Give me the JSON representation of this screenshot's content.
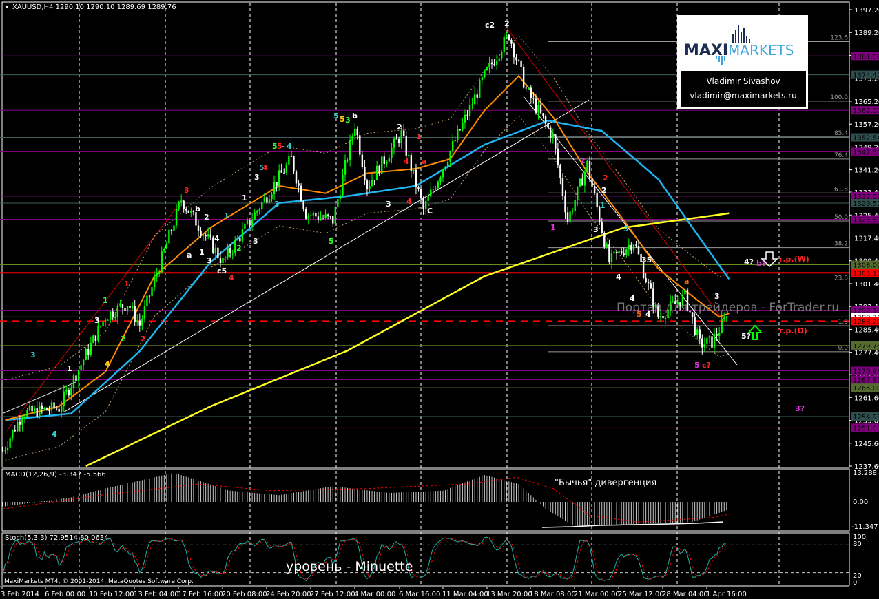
{
  "header": {
    "symbol_line": "XAUUSD,H4  1290.10  1290.10  1289.69  1289.76"
  },
  "footer": {
    "copyright": "MaxiMarkets MT4, © 2001-2014, MetaQuotes Software Corp."
  },
  "logo": {
    "brand_a": "MAXI",
    "brand_b": "MARKETS",
    "author": "Vladimir Sivashov",
    "email": "vladimir@maximarkets.ru"
  },
  "watermark": "Портал для трейдеров - ForTrader.ru",
  "captions": {
    "divergence": "\"Бычья\" дивергенция",
    "level": "уровень - Minuette"
  },
  "targets": {
    "w": "т.р.(W)",
    "d": "т.р.(D)"
  },
  "colors": {
    "bull": "#00ff00",
    "bear": "#ffffff",
    "ma_fast": "#ff8c00",
    "ma_mid": "#1eb4f0",
    "ma_slow": "#ffff22",
    "support": "#ff0000",
    "level_purple": "#b000b0"
  },
  "chart_data": {
    "type": "candlestick",
    "title": "XAUUSD,H4",
    "ohlc_last": {
      "open": 1290.1,
      "high": 1290.1,
      "low": 1289.69,
      "close": 1289.76
    },
    "ylim": [
      1237.6,
      1397.2
    ],
    "price_ticks": [
      "1397.20",
      "1389.20",
      "1381.20",
      "1373.20",
      "1365.20",
      "1357.20",
      "1349.20",
      "1341.20",
      "1333.40",
      "1325.40",
      "1317.40",
      "1309.40",
      "1301.40",
      "1293.40",
      "1285.40",
      "1277.40",
      "1269.60",
      "1261.60",
      "1253.60",
      "1245.60",
      "1237.60"
    ],
    "time_ticks": [
      "3 Feb 2014",
      "6 Feb 00:00",
      "10 Feb 12:00",
      "13 Feb 04:00",
      "17 Feb 16:00",
      "20 Feb 08:00",
      "24 Feb 20:00",
      "27 Feb 12:00",
      "4 Mar 00:00",
      "6 Mar 16:00",
      "11 Mar 04:00",
      "13 Mar 20:00",
      "18 Mar 08:00",
      "21 Mar 00:00",
      "25 Mar 12:00",
      "28 Mar 04:00",
      "1 Apr 16:00"
    ],
    "price_pivots_bar_price": [
      [
        0,
        1243
      ],
      [
        8,
        1256
      ],
      [
        23,
        1258
      ],
      [
        42,
        1290
      ],
      [
        51,
        1294.6
      ],
      [
        56,
        1287
      ],
      [
        73,
        1330.8
      ],
      [
        90,
        1309
      ],
      [
        118,
        1345
      ],
      [
        124,
        1326
      ],
      [
        135,
        1323.5
      ],
      [
        144,
        1357.2
      ],
      [
        149,
        1335.6
      ],
      [
        163,
        1353.7
      ],
      [
        172,
        1327.2
      ],
      [
        183,
        1347.7
      ],
      [
        197,
        1374
      ],
      [
        207,
        1388.5
      ],
      [
        214,
        1369.3
      ],
      [
        225,
        1352.5
      ],
      [
        231,
        1323.5
      ],
      [
        239,
        1343
      ],
      [
        248,
        1309
      ],
      [
        258,
        1316.3
      ],
      [
        268,
        1289.8
      ],
      [
        279,
        1297
      ],
      [
        285,
        1280.2
      ],
      [
        290,
        1281
      ],
      [
        296,
        1289.76
      ]
    ],
    "ma_fast": [
      [
        1,
        1253.7
      ],
      [
        23,
        1258.5
      ],
      [
        42,
        1270.6
      ],
      [
        62,
        1304
      ],
      [
        85,
        1321
      ],
      [
        113,
        1335.6
      ],
      [
        132,
        1333
      ],
      [
        149,
        1340
      ],
      [
        169,
        1341.6
      ],
      [
        183,
        1345
      ],
      [
        197,
        1362
      ],
      [
        211,
        1374
      ],
      [
        225,
        1359.7
      ],
      [
        239,
        1340.4
      ],
      [
        254,
        1323.5
      ],
      [
        268,
        1306.7
      ],
      [
        282,
        1297
      ],
      [
        293,
        1289.8
      ],
      [
        297,
        1291
      ]
    ],
    "ma_mid": [
      [
        1,
        1253.7
      ],
      [
        28,
        1256
      ],
      [
        56,
        1277.8
      ],
      [
        85,
        1309
      ],
      [
        113,
        1329.6
      ],
      [
        141,
        1332
      ],
      [
        169,
        1335.6
      ],
      [
        197,
        1350
      ],
      [
        223,
        1358.4
      ],
      [
        245,
        1354.8
      ],
      [
        268,
        1338
      ],
      [
        282,
        1321
      ],
      [
        297,
        1303
      ]
    ],
    "ma_slow": [
      [
        34,
        1237.6
      ],
      [
        85,
        1258.5
      ],
      [
        141,
        1278
      ],
      [
        197,
        1304
      ],
      [
        254,
        1321
      ],
      [
        297,
        1326
      ]
    ],
    "fibo_levels": [
      {
        "label": "123.6",
        "price": 1386
      },
      {
        "label": "100.0",
        "price": 1365.2
      },
      {
        "label": "85.4",
        "price": 1352.7
      },
      {
        "label": "76.4",
        "price": 1345
      },
      {
        "label": "61.8",
        "price": 1333.1
      },
      {
        "label": "50.0",
        "price": 1323.3
      },
      {
        "label": "38.2",
        "price": 1314
      },
      {
        "label": "23.6",
        "price": 1302
      },
      {
        "label": "1.8",
        "price": 1286.7
      },
      {
        "label": "0.0",
        "price": 1277.6
      }
    ],
    "price_tags": [
      {
        "label": "1381.00",
        "color": "#800080"
      },
      {
        "label": "1374.42",
        "color": "#2f4f4f"
      },
      {
        "label": "1362.00",
        "color": "#800080"
      },
      {
        "label": "1352.54",
        "color": "#2f4f4f"
      },
      {
        "label": "1347.50",
        "color": "#800080"
      },
      {
        "label": "1332.00",
        "color": "#800080"
      },
      {
        "label": "1329.57",
        "color": "#2f4f4f"
      },
      {
        "label": "1323.89",
        "color": "#800080"
      },
      {
        "label": "1308.00",
        "color": "#556b2f"
      },
      {
        "label": "1305.17",
        "color": "#ff0000"
      },
      {
        "label": "1292.10",
        "color": "#800080"
      },
      {
        "label": "1289.76",
        "color": "#ffffff"
      },
      {
        "label": "1288.29",
        "color": "#ff0000"
      },
      {
        "label": "1279.76",
        "color": "#556b2f"
      },
      {
        "label": "1270.93",
        "color": "#800080"
      },
      {
        "label": "1267.82",
        "color": "#800080"
      },
      {
        "label": "1265.00",
        "color": "#556b2f"
      },
      {
        "label": "1254.93",
        "color": "#2f4f4f"
      },
      {
        "label": "1251.00",
        "color": "#800080"
      }
    ],
    "macd": {
      "label": "MACD(12,26,9) -3.347 -5.566",
      "ticks": [
        "13.288",
        "0.00",
        "-11.347"
      ],
      "range": [
        -11.347,
        13.288
      ],
      "hist_pivots": [
        [
          1,
          -2
        ],
        [
          28,
          2
        ],
        [
          42,
          6
        ],
        [
          70,
          13
        ],
        [
          93,
          5
        ],
        [
          113,
          3
        ],
        [
          135,
          7
        ],
        [
          158,
          4
        ],
        [
          180,
          5
        ],
        [
          197,
          12
        ],
        [
          211,
          8
        ],
        [
          222,
          -3
        ],
        [
          234,
          -11
        ],
        [
          254,
          -10
        ],
        [
          282,
          -9
        ],
        [
          297,
          -3.347
        ]
      ],
      "signal_pivots": [
        [
          1,
          -3
        ],
        [
          40,
          3
        ],
        [
          80,
          8
        ],
        [
          110,
          5
        ],
        [
          150,
          6
        ],
        [
          190,
          8
        ],
        [
          210,
          11
        ],
        [
          225,
          6
        ],
        [
          240,
          -6
        ],
        [
          260,
          -9
        ],
        [
          290,
          -7
        ],
        [
          297,
          -5.566
        ]
      ]
    },
    "stoch": {
      "label": "Stoch(5,3,3) 72.9514 80.0634",
      "ticks": [
        "100",
        "80",
        "20",
        "0"
      ]
    },
    "wave_labels": [
      "3",
      "4",
      "4",
      "1",
      "3",
      "1",
      "2",
      "1",
      "2",
      "3",
      "b",
      "2",
      "a",
      "1",
      "3",
      "4",
      "c5",
      "4",
      "1",
      "2",
      "1",
      "3",
      "3",
      "5",
      "4",
      "3",
      "5",
      "5",
      "4",
      "5",
      "5",
      "5",
      "3",
      "b",
      "2",
      "1",
      "4",
      "a",
      "3",
      "4",
      "C",
      "c2",
      "2",
      "2",
      "2",
      "2",
      "1",
      "1",
      "3",
      "4",
      "35",
      "4",
      "3",
      "5",
      "4",
      "a",
      "3",
      "5",
      "c?",
      "4?",
      "b?",
      "5?",
      "3?"
    ]
  }
}
